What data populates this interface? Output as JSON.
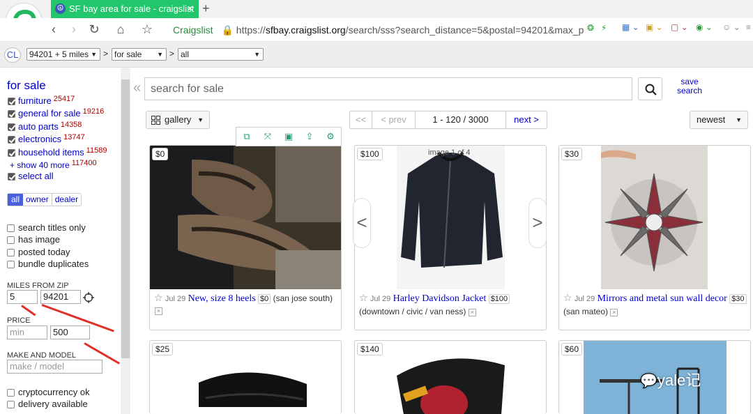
{
  "browser": {
    "tab_title": "SF bay area for sale - craigslist",
    "address_site": "Craigslist",
    "address_scheme": "https://",
    "address_host": "sfbay.craigslist.org",
    "address_path": "/search/sss?search_distance=5&postal=94201&max_pr"
  },
  "cl_nav": {
    "home": "CL",
    "area": "94201 + 5 miles",
    "category": "for sale",
    "subcategory": "all"
  },
  "sidebar": {
    "heading": "for sale",
    "categories": [
      {
        "label": "furniture",
        "count": "25417"
      },
      {
        "label": "general for sale",
        "count": "19216"
      },
      {
        "label": "auto parts",
        "count": "14358"
      },
      {
        "label": "electronics",
        "count": "13747"
      },
      {
        "label": "household items",
        "count": "11589"
      }
    ],
    "show_more": "+ show 40 more",
    "show_more_count": "117400",
    "select_all": "select all",
    "seller_tabs": [
      "all",
      "owner",
      "dealer"
    ],
    "options": [
      "search titles only",
      "has image",
      "posted today",
      "bundle duplicates"
    ],
    "miles_label": "MILES FROM ZIP",
    "miles_value": "5",
    "zip_value": "94201",
    "price_label": "PRICE",
    "price_min_placeholder": "min",
    "price_max_value": "500",
    "make_label": "MAKE AND MODEL",
    "make_placeholder": "make / model",
    "extra_options": [
      "cryptocurrency ok",
      "delivery available"
    ]
  },
  "main": {
    "search_placeholder": "search for sale",
    "save_search": "save search",
    "view_mode": "gallery",
    "pager": {
      "first": "<<",
      "prev": "< prev",
      "range": "1 - 120 / 3000",
      "next": "next >"
    },
    "sort": "newest",
    "image_counter": "image 1 of 4"
  },
  "listings": [
    {
      "price": "$0",
      "date": "Jul 29",
      "title": "New, size 8 heels",
      "tag": "$0",
      "hood": "(san jose south)"
    },
    {
      "price": "$100",
      "date": "Jul 29",
      "title": "Harley Davidson Jacket",
      "tag": "$100",
      "hood": "(downtown / civic / van ness)"
    },
    {
      "price": "$30",
      "date": "Jul 29",
      "title": "Mirrors and metal sun wall decor",
      "tag": "$30",
      "hood": "(san mateo)"
    },
    {
      "price": "$25"
    },
    {
      "price": "$140"
    },
    {
      "price": "$60"
    }
  ],
  "watermark": "yale记",
  "colors": {
    "tab": "#22c76b",
    "link": "#0000cc",
    "annotation_arrow": "#e0302a"
  }
}
